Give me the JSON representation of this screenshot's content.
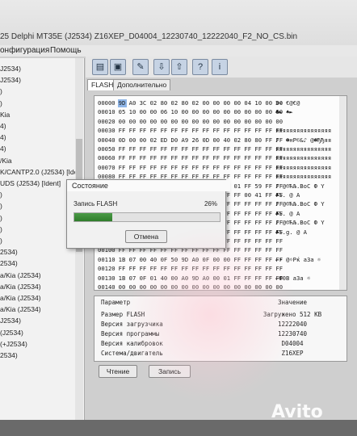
{
  "window": {
    "title": "25 Delphi MT35E (J2534) Z16XEP_D04004_12230740_12222040_F2_NO_CS.bin"
  },
  "menu": [
    {
      "label": "онфигурация"
    },
    {
      "label": "Помощь"
    }
  ],
  "tree": [
    {
      "label": "J2534)"
    },
    {
      "label": "J2534)"
    },
    {
      "label": ")"
    },
    {
      "label": ")"
    },
    {
      "label": "Kia"
    },
    {
      "label": "4)"
    },
    {
      "label": "4)"
    },
    {
      "label": "4)"
    },
    {
      "label": "/Kia"
    },
    {
      "label": "K/CANTP2.0 (J2534) [Ide"
    },
    {
      "label": "UDS (J2534) [Ident]"
    },
    {
      "label": ")"
    },
    {
      "label": ")"
    },
    {
      "label": ")"
    },
    {
      "label": ")"
    },
    {
      "label": ")"
    },
    {
      "label": "2534)"
    },
    {
      "label": "2534)"
    },
    {
      "label": "a/Kia (J2534)"
    },
    {
      "label": "a/Kia (J2534)"
    },
    {
      "label": "a/Kia (J2534)"
    },
    {
      "label": "a/Kia (J2534)"
    },
    {
      "label": "J2534)"
    },
    {
      "label": "(J2534)"
    },
    {
      "label": "(+J2534)"
    },
    {
      "label": "2534)"
    }
  ],
  "toolbar": {
    "icons": [
      "open-folder-icon",
      "save-icon",
      "edit-icon",
      "read-icon",
      "write-icon",
      "help-icon",
      "info-icon"
    ]
  },
  "tabs": [
    {
      "label": "FLASH"
    },
    {
      "label": "Дополнительно"
    }
  ],
  "hex": {
    "rows": [
      {
        "addr": "00000",
        "bytes": "9D A0 3C 02 80 02 80 02 00 00 00 00 04 10 00 00",
        "ascii": "Э< €@€@"
      },
      {
        "addr": "00010",
        "bytes": "05 10 00 00 06 10 00 00 00 00 00 00 00 00 00 00",
        "ascii": "♣► ♠►"
      },
      {
        "addr": "00020",
        "bytes": "00 00 00 00 00 00 00 00 00 00 00 00 00 00 00 00",
        "ascii": ""
      },
      {
        "addr": "00030",
        "bytes": "FF FF FF FF FF FF FF FF FF FF FF FF FF FF FF FF",
        "ascii": "яяяяяяяяяяяяяяяя"
      },
      {
        "addr": "00040",
        "bytes": "0D 00 00 02 ED D0 A9 26 0D 00 40 02 80 80 FF FF",
        "ascii": "♪  ☻нР©&♪ @☻ЂЂяя"
      },
      {
        "addr": "00050",
        "bytes": "FF FF FF FF FF FF FF FF FF FF FF FF FF FF FF FF",
        "ascii": "яяяяяяяяяяяяяяяя"
      },
      {
        "addr": "00060",
        "bytes": "FF FF FF FF FF FF FF FF FF FF FF FF FF FF FF FF",
        "ascii": "яяяяяяяяяяяяяяяя"
      },
      {
        "addr": "00070",
        "bytes": "FF FF FF FF FF FF FF FF FF FF FF FF FF FF FF FF",
        "ascii": "яяяяяяяяяяяяяяяя"
      },
      {
        "addr": "00080",
        "bytes": "FF FF FF FF FF FF FF FF FF FF FF FF FF FF FF FF",
        "ascii": "яяяяяяяяяяяяяяяя"
      },
      {
        "addr": "00090",
        "bytes": "FF FF FF FF FF FF FF FF FF FF 00 01 FF 59 FF FF",
        "ascii": "♪ @☺ЋЉ.ВоС Ф Y"
      },
      {
        "addr": "000A0",
        "bytes": "FF FF FF FF FF FF FF FF FF FF FF FF 00 41 FF FF",
        "ascii": "♣Ъ. @ А"
      },
      {
        "addr": "000B0",
        "bytes": "FF FF FF FF FF FF FF FF FF FF FF FF FF FF FF FF",
        "ascii": "♪ @☺ЋЉ.ВоС Ф Y"
      },
      {
        "addr": "000C0",
        "bytes": "FF FF FF FF FF FF FF FF FF FF FF FF FF FF FF FF",
        "ascii": "♣Ъ. @ А"
      },
      {
        "addr": "000D0",
        "bytes": "FF FF FF FF FF FF FF FF FF FF FF FF FF FF FF FF",
        "ascii": "♪ @☺ЋЉ.ВоС Ф Y"
      },
      {
        "addr": "000E0",
        "bytes": "FF FF FF FF FF FF FF FF FF FF FF FF FF FF FF FF",
        "ascii": "♣Ъ.g. @ А"
      },
      {
        "addr": "000F0",
        "bytes": "FF FF FF FF FF FF FF FF FF FF FF FF FF FF FF FF",
        "ascii": ""
      },
      {
        "addr": "00100",
        "bytes": "FF FF FF FF FF FF FF FF FF FF FF FF FF FF FF FF",
        "ascii": ""
      },
      {
        "addr": "00110",
        "bytes": "1B 07 00 40 0F 50 9D A0 0F 00 00 FF FF FF FF FF",
        "ascii": "←• @☼Рќ a3a ☼"
      },
      {
        "addr": "00120",
        "bytes": "FF FF FF FF FF FF FF FF FF FF FF FF FF FF FF FF",
        "ascii": ""
      },
      {
        "addr": "00130",
        "bytes": "1B 07 0F 01 40 00 A0 9D A0 00 01 FF FF FF FF FF",
        "ascii": "←Ф0В a3a ☼"
      },
      {
        "addr": "00140",
        "bytes": "00 00 00 00 00 00 00 00 00 00 00 00 00 00 00 00",
        "ascii": ""
      }
    ]
  },
  "info": {
    "header": {
      "param": "Параметр",
      "value": "Значение"
    },
    "rows": [
      {
        "param": "Размер FLASH",
        "value": "Загружено 512 KB"
      },
      {
        "param": "Версия загрузчика",
        "value": "12222040"
      },
      {
        "param": "Версия программы",
        "value": "12230740"
      },
      {
        "param": "Версия калибровок",
        "value": "D04004"
      },
      {
        "param": "Система/двигатель",
        "value": "Z16XEP"
      }
    ]
  },
  "buttons": {
    "read": "Чтение",
    "write": "Запись"
  },
  "dialog": {
    "title": "Состояние",
    "label": "Запись FLASH",
    "percent_text": "26%",
    "progress": 0.26,
    "cancel": "Отмена"
  },
  "watermark": "Avito"
}
